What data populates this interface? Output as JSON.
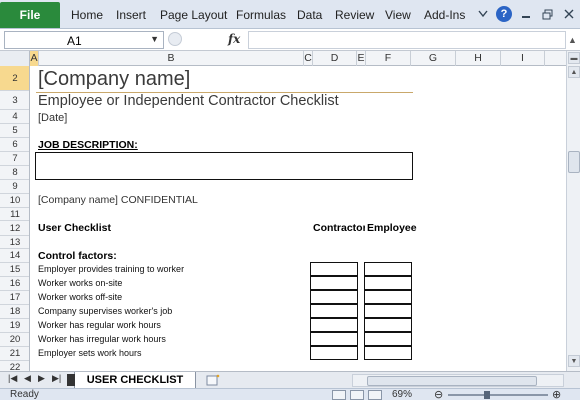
{
  "ribbon": {
    "file_label": "File",
    "tabs": [
      "Home",
      "Insert",
      "Page Layout",
      "Formulas",
      "Data",
      "Review",
      "View",
      "Add-Ins"
    ],
    "help_label": "?"
  },
  "formula_bar": {
    "name_box": "A1",
    "fx_label": "fx",
    "value": ""
  },
  "columns": [
    "A",
    "B",
    "C",
    "D",
    "E",
    "F",
    "G",
    "H",
    "I"
  ],
  "rows": [
    "2",
    "3",
    "4",
    "5",
    "6",
    "7",
    "8",
    "9",
    "10",
    "11",
    "12",
    "13",
    "14",
    "15",
    "16",
    "17",
    "18",
    "19",
    "20",
    "21",
    "22"
  ],
  "sheet": {
    "company_name": "[Company name]",
    "subtitle": "Employee or Independent Contractor Checklist",
    "date": "[Date]",
    "job_description_label": "JOB DESCRIPTION:",
    "confidential": "[Company name] CONFIDENTIAL",
    "user_checklist_label": "User Checklist",
    "contractor_header": "Contractor",
    "employee_header": "Employee",
    "control_factors_label": "Control factors:",
    "items": [
      "Employer provides training to worker",
      "Worker works on-site",
      "Worker works off-site",
      "Company supervises worker's job",
      "Worker has regular work hours",
      "Worker has irregular work hours",
      "Employer sets work hours"
    ]
  },
  "sheet_tabs": {
    "active": "USER CHECKLIST"
  },
  "status_bar": {
    "ready": "Ready",
    "zoom": "69%"
  },
  "colors": {
    "file_tab": "#2a8a3c",
    "selected_header": "#f7d98f",
    "title_underline": "#c9a86b"
  }
}
